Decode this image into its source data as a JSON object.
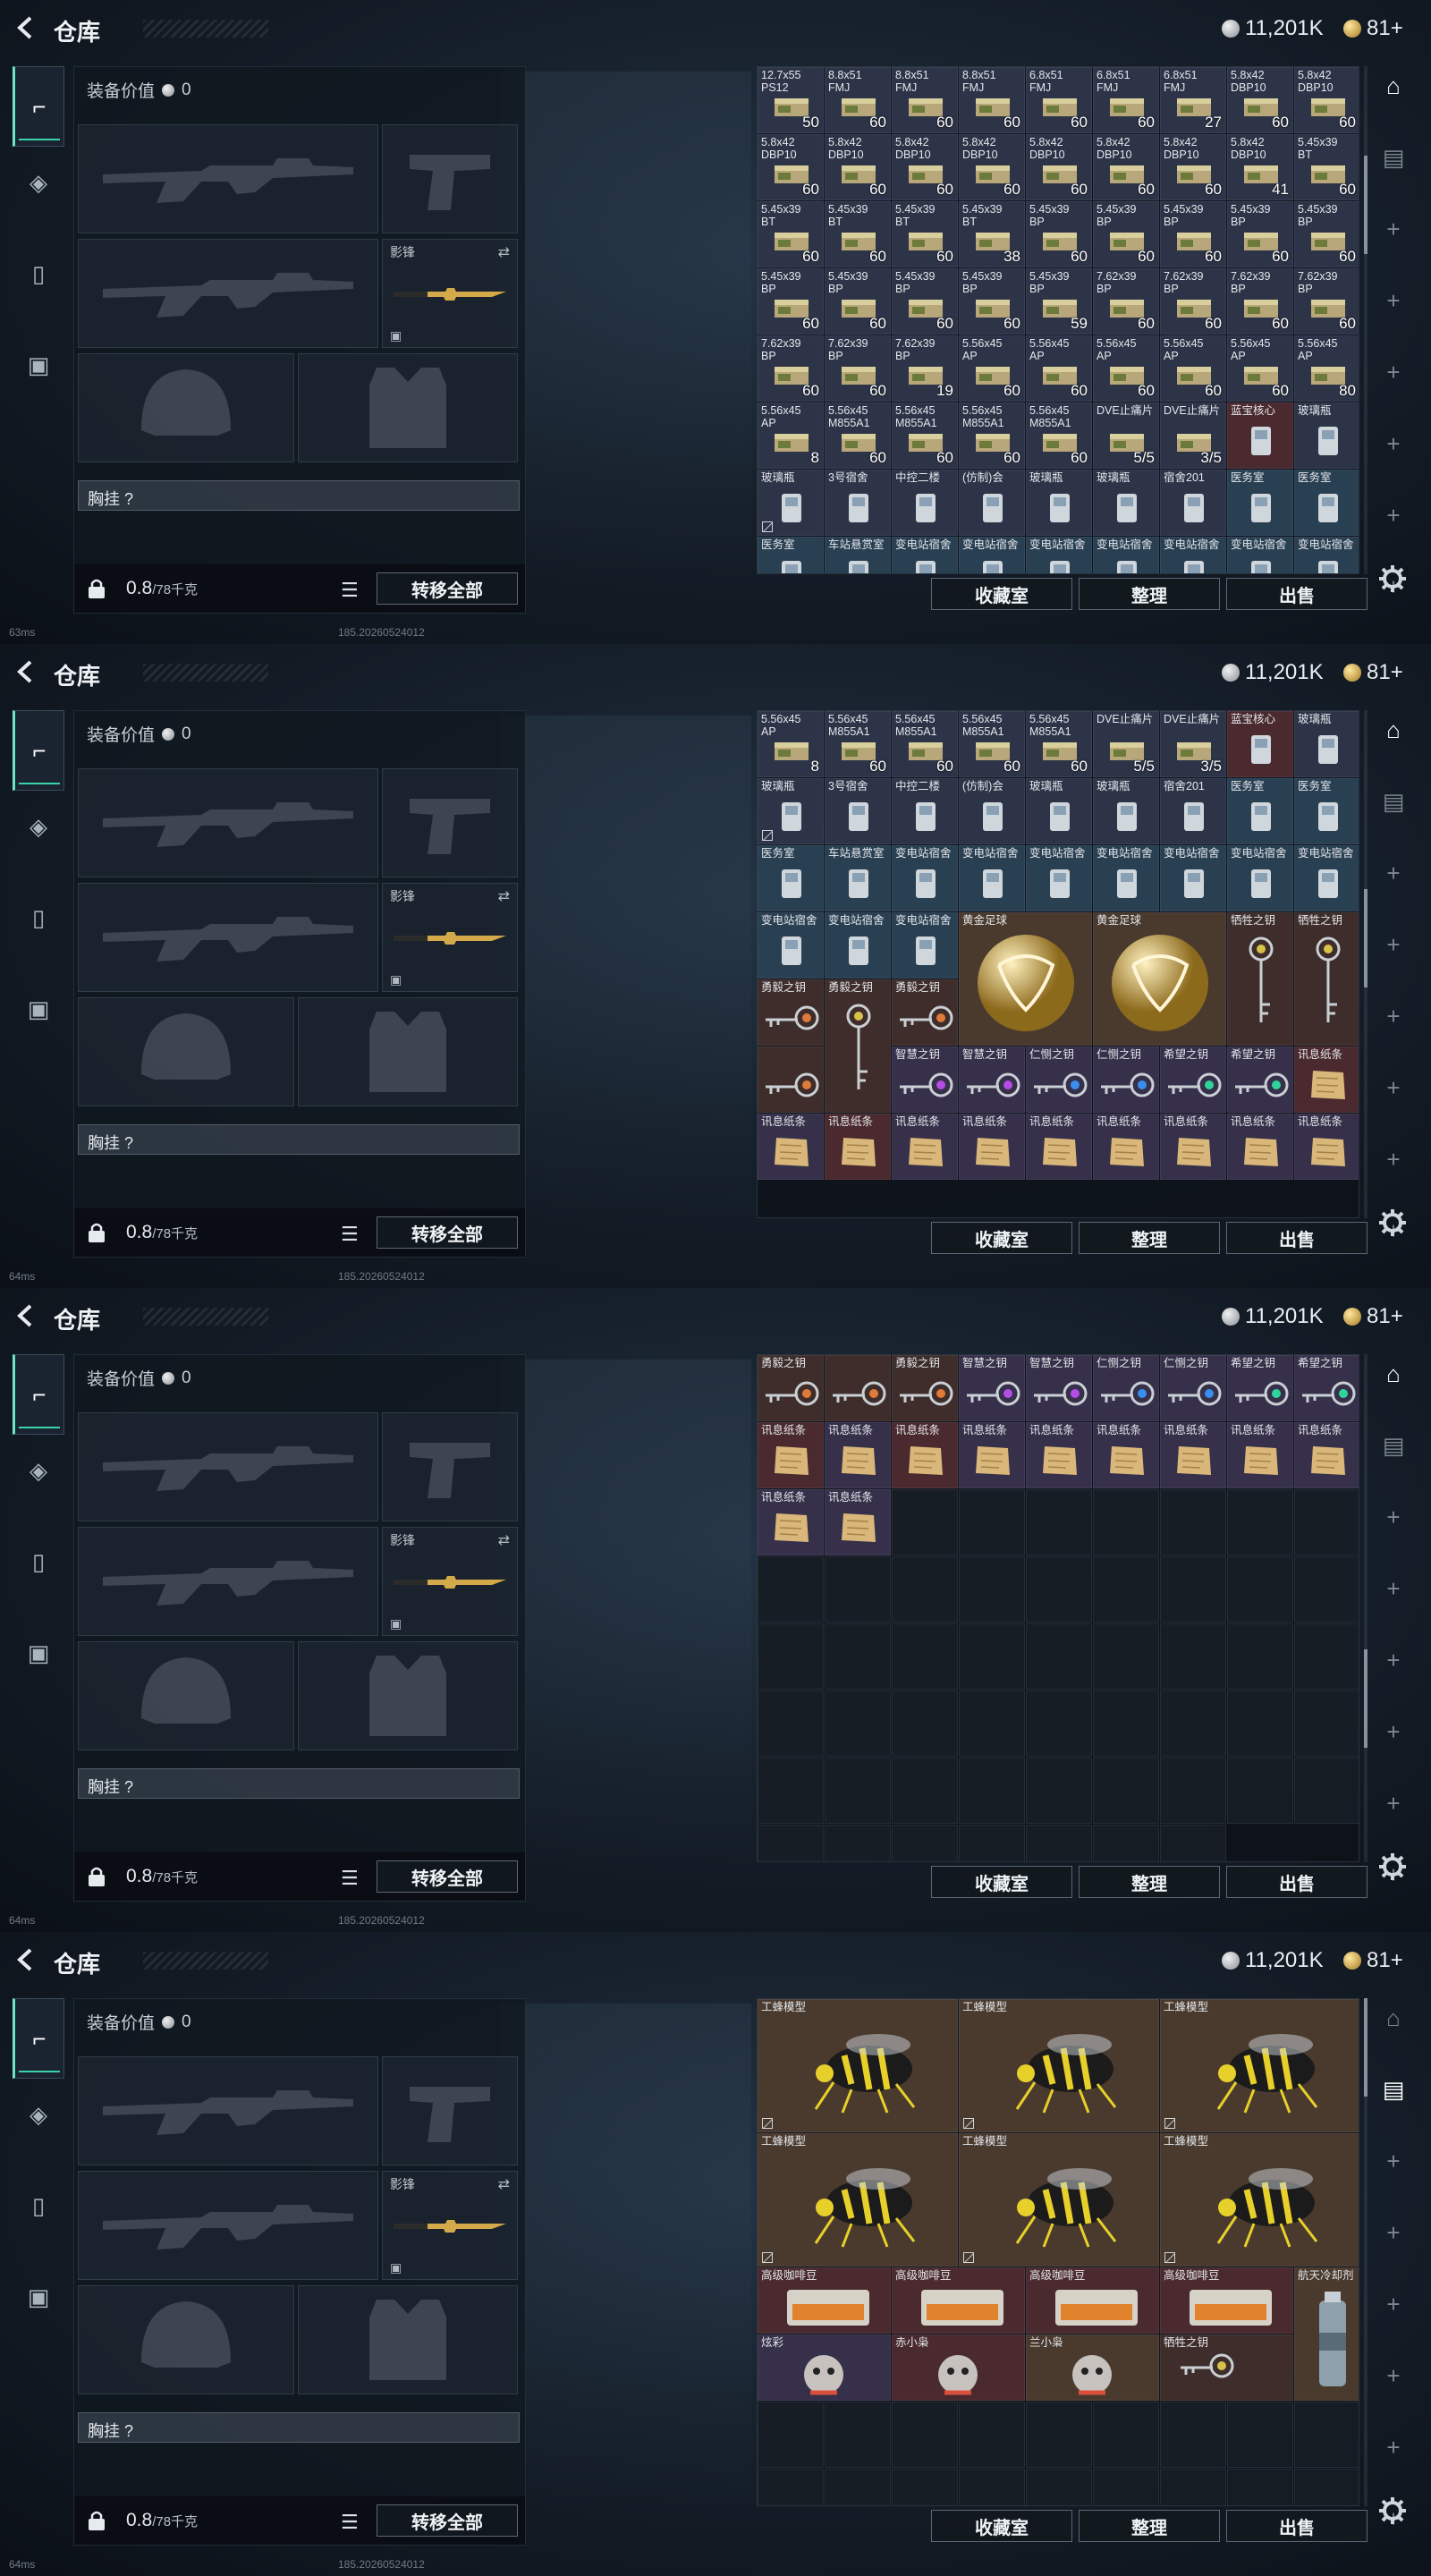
{
  "topbar": {
    "title": "仓库",
    "silver": "11,201K",
    "gold": "81+"
  },
  "equipment": {
    "value_label": "装备价值",
    "value": "0",
    "melee_label": "影锋",
    "chest_label": "胸挂 ?",
    "weight_value": "0.8",
    "weight_cap": "/78千克",
    "transfer_all": "转移全部"
  },
  "actions": {
    "collection": "收藏室",
    "sort": "整理",
    "sell": "出售"
  },
  "panels": [
    {
      "ping": "63ms",
      "version": "185.20260524012"
    },
    {
      "ping": "64ms",
      "version": "185.20260524012"
    },
    {
      "ping": "64ms",
      "version": "185.20260524012"
    },
    {
      "ping": "64ms",
      "version": "185.20260524012"
    }
  ],
  "grids": [
    [
      {
        "l": "12.7x55\nPS12",
        "c": "50",
        "t": "ammo"
      },
      {
        "l": "8.8x51\nFMJ",
        "c": "60",
        "t": "ammo"
      },
      {
        "l": "8.8x51\nFMJ",
        "c": "60",
        "t": "ammo"
      },
      {
        "l": "8.8x51\nFMJ",
        "c": "60",
        "t": "ammo"
      },
      {
        "l": "6.8x51\nFMJ",
        "c": "60",
        "t": "ammo"
      },
      {
        "l": "6.8x51\nFMJ",
        "c": "60",
        "t": "ammo"
      },
      {
        "l": "6.8x51\nFMJ",
        "c": "27",
        "t": "ammo"
      },
      {
        "l": "5.8x42\nDBP10",
        "c": "60",
        "t": "ammo"
      },
      {
        "l": "5.8x42\nDBP10",
        "c": "60",
        "t": "ammo"
      },
      {
        "l": "5.8x42\nDBP10",
        "c": "60",
        "t": "ammo"
      },
      {
        "l": "5.8x42\nDBP10",
        "c": "60",
        "t": "ammo"
      },
      {
        "l": "5.8x42\nDBP10",
        "c": "60",
        "t": "ammo"
      },
      {
        "l": "5.8x42\nDBP10",
        "c": "60",
        "t": "ammo"
      },
      {
        "l": "5.8x42\nDBP10",
        "c": "60",
        "t": "ammo"
      },
      {
        "l": "5.8x42\nDBP10",
        "c": "60",
        "t": "ammo"
      },
      {
        "l": "5.8x42\nDBP10",
        "c": "60",
        "t": "ammo"
      },
      {
        "l": "5.8x42\nDBP10",
        "c": "41",
        "t": "ammo"
      },
      {
        "l": "5.45x39\nBT",
        "c": "60",
        "t": "ammo"
      },
      {
        "l": "5.45x39\nBT",
        "c": "60",
        "t": "ammo"
      },
      {
        "l": "5.45x39\nBT",
        "c": "60",
        "t": "ammo"
      },
      {
        "l": "5.45x39\nBT",
        "c": "60",
        "t": "ammo"
      },
      {
        "l": "5.45x39\nBT",
        "c": "38",
        "t": "ammo"
      },
      {
        "l": "5.45x39\nBP",
        "c": "60",
        "t": "ammo"
      },
      {
        "l": "5.45x39\nBP",
        "c": "60",
        "t": "ammo"
      },
      {
        "l": "5.45x39\nBP",
        "c": "60",
        "t": "ammo"
      },
      {
        "l": "5.45x39\nBP",
        "c": "60",
        "t": "ammo"
      },
      {
        "l": "5.45x39\nBP",
        "c": "60",
        "t": "ammo"
      },
      {
        "l": "5.45x39\nBP",
        "c": "60",
        "t": "ammo"
      },
      {
        "l": "5.45x39\nBP",
        "c": "60",
        "t": "ammo"
      },
      {
        "l": "5.45x39\nBP",
        "c": "60",
        "t": "ammo"
      },
      {
        "l": "5.45x39\nBP",
        "c": "60",
        "t": "ammo"
      },
      {
        "l": "5.45x39\nBP",
        "c": "59",
        "t": "ammo"
      },
      {
        "l": "7.62x39\nBP",
        "c": "60",
        "t": "ammo"
      },
      {
        "l": "7.62x39\nBP",
        "c": "60",
        "t": "ammo"
      },
      {
        "l": "7.62x39\nBP",
        "c": "60",
        "t": "ammo"
      },
      {
        "l": "7.62x39\nBP",
        "c": "60",
        "t": "ammo"
      },
      {
        "l": "7.62x39\nBP",
        "c": "60",
        "t": "ammo"
      },
      {
        "l": "7.62x39\nBP",
        "c": "60",
        "t": "ammo"
      },
      {
        "l": "7.62x39\nBP",
        "c": "19",
        "t": "ammo"
      },
      {
        "l": "5.56x45\nAP",
        "c": "60",
        "t": "ammo"
      },
      {
        "l": "5.56x45\nAP",
        "c": "60",
        "t": "ammo"
      },
      {
        "l": "5.56x45\nAP",
        "c": "60",
        "t": "ammo"
      },
      {
        "l": "5.56x45\nAP",
        "c": "60",
        "t": "ammo"
      },
      {
        "l": "5.56x45\nAP",
        "c": "60",
        "t": "ammo"
      },
      {
        "l": "5.56x45\nAP",
        "c": "80",
        "t": "ammo"
      },
      {
        "l": "5.56x45\nAP",
        "c": "8",
        "t": "ammo"
      },
      {
        "l": "5.56x45\nM855A1",
        "c": "60",
        "t": "ammo"
      },
      {
        "l": "5.56x45\nM855A1",
        "c": "60",
        "t": "ammo"
      },
      {
        "l": "5.56x45\nM855A1",
        "c": "60",
        "t": "ammo"
      },
      {
        "l": "5.56x45\nM855A1",
        "c": "60",
        "t": "ammo"
      },
      {
        "l": "DVE止痛片",
        "c": "5/5",
        "t": "ammo"
      },
      {
        "l": "DVE止痛片",
        "c": "3/5",
        "t": "ammo"
      },
      {
        "l": "蓝宝核心",
        "c": "",
        "t": "redish"
      },
      {
        "l": "玻璃瓶",
        "c": "",
        "t": "ammo"
      },
      {
        "l": "玻璃瓶",
        "c": "",
        "t": "ammo",
        "nb": true
      },
      {
        "l": "3号宿舍",
        "c": "",
        "t": "ammo"
      },
      {
        "l": "中控二楼",
        "c": "",
        "t": "ammo"
      },
      {
        "l": "(仿制)会",
        "c": "",
        "t": "ammo"
      },
      {
        "l": "玻璃瓶",
        "c": "",
        "t": "ammo"
      },
      {
        "l": "玻璃瓶",
        "c": "",
        "t": "ammo"
      },
      {
        "l": "宿舍201",
        "c": "",
        "t": "ammo"
      },
      {
        "l": "医务室",
        "c": "",
        "t": "blue"
      },
      {
        "l": "医务室",
        "c": "",
        "t": "blue"
      },
      {
        "l": "医务室",
        "c": "",
        "t": "blue"
      },
      {
        "l": "车站悬赏室",
        "c": "",
        "t": "blue"
      },
      {
        "l": "变电站宿舍",
        "c": "",
        "t": "blue"
      },
      {
        "l": "变电站宿舍",
        "c": "",
        "t": "blue"
      },
      {
        "l": "变电站宿舍",
        "c": "",
        "t": "blue"
      },
      {
        "l": "变电站宿舍",
        "c": "",
        "t": "blue"
      },
      {
        "l": "变电站宿舍",
        "c": "",
        "t": "blue"
      },
      {
        "l": "变电站宿舍",
        "c": "",
        "t": "blue"
      },
      {
        "l": "变电站宿舍",
        "c": "",
        "t": "blue"
      }
    ],
    [
      {
        "l": "5.56x45\nAP",
        "c": "8",
        "t": "ammo"
      },
      {
        "l": "5.56x45\nM855A1",
        "c": "60",
        "t": "ammo"
      },
      {
        "l": "5.56x45\nM855A1",
        "c": "60",
        "t": "ammo"
      },
      {
        "l": "5.56x45\nM855A1",
        "c": "60",
        "t": "ammo"
      },
      {
        "l": "5.56x45\nM855A1",
        "c": "60",
        "t": "ammo"
      },
      {
        "l": "DVE止痛片",
        "c": "5/5",
        "t": "ammo"
      },
      {
        "l": "DVE止痛片",
        "c": "3/5",
        "t": "ammo"
      },
      {
        "l": "蓝宝核心",
        "c": "",
        "t": "redish"
      },
      {
        "l": "玻璃瓶",
        "c": "",
        "t": "ammo"
      },
      {
        "l": "玻璃瓶",
        "c": "",
        "t": "ammo",
        "nb": true
      },
      {
        "l": "3号宿舍",
        "c": "",
        "t": "ammo"
      },
      {
        "l": "中控二楼",
        "c": "",
        "t": "ammo"
      },
      {
        "l": "(仿制)会",
        "c": "",
        "t": "ammo"
      },
      {
        "l": "玻璃瓶",
        "c": "",
        "t": "ammo"
      },
      {
        "l": "玻璃瓶",
        "c": "",
        "t": "ammo"
      },
      {
        "l": "宿舍201",
        "c": "",
        "t": "ammo"
      },
      {
        "l": "医务室",
        "c": "",
        "t": "blue"
      },
      {
        "l": "医务室",
        "c": "",
        "t": "blue"
      },
      {
        "l": "医务室",
        "c": "",
        "t": "blue"
      },
      {
        "l": "车站悬赏室",
        "c": "",
        "t": "blue"
      },
      {
        "l": "变电站宿舍",
        "c": "",
        "t": "blue"
      },
      {
        "l": "变电站宿舍",
        "c": "",
        "t": "blue"
      },
      {
        "l": "变电站宿舍",
        "c": "",
        "t": "blue"
      },
      {
        "l": "变电站宿舍",
        "c": "",
        "t": "blue"
      },
      {
        "l": "变电站宿舍",
        "c": "",
        "t": "blue"
      },
      {
        "l": "变电站宿舍",
        "c": "",
        "t": "blue"
      },
      {
        "l": "变电站宿舍",
        "c": "",
        "t": "blue"
      },
      {
        "l": "变电站宿舍",
        "c": "",
        "t": "blue"
      },
      {
        "l": "变电站宿舍",
        "c": "",
        "t": "blue"
      },
      {
        "l": "变电站宿舍",
        "c": "",
        "t": "blue"
      },
      {
        "l": "黄金足球",
        "c": "",
        "t": "brown",
        "s": "big2",
        "a": "ball"
      },
      {
        "l": "黄金足球",
        "c": "",
        "t": "brown",
        "s": "big2",
        "a": "ball"
      },
      {
        "l": "牺牲之钥",
        "c": "",
        "t": "keyc",
        "s": "tall",
        "a": "vkey"
      },
      {
        "l": "牺牲之钥",
        "c": "",
        "t": "keyc",
        "s": "tall",
        "a": "vkey"
      },
      {
        "l": "勇毅之钥",
        "c": "",
        "t": "keyc",
        "a": "key",
        "k": "#e07a3a"
      },
      {
        "l": "勇毅之钥",
        "c": "",
        "t": "keyc",
        "s": "tall",
        "a": "vkey"
      },
      {
        "l": "勇毅之钥",
        "c": "",
        "t": "keyc",
        "a": "key",
        "k": "#e07a3a"
      },
      {
        "l": "",
        "c": "",
        "t": "keyc",
        "a": "key",
        "k": "#e07a3a"
      },
      {
        "l": "智慧之钥",
        "c": "",
        "t": "purple",
        "a": "key",
        "k": "#b44ce6"
      },
      {
        "l": "智慧之钥",
        "c": "",
        "t": "purple",
        "a": "key",
        "k": "#b44ce6"
      },
      {
        "l": "仁恻之钥",
        "c": "",
        "t": "purple",
        "a": "key",
        "k": "#3a8ef0"
      },
      {
        "l": "仁恻之钥",
        "c": "",
        "t": "purple",
        "a": "key",
        "k": "#3a8ef0"
      },
      {
        "l": "希望之钥",
        "c": "",
        "t": "purple",
        "a": "key",
        "k": "#2fd39c"
      },
      {
        "l": "希望之钥",
        "c": "",
        "t": "purple",
        "a": "key",
        "k": "#2fd39c"
      },
      {
        "l": "讯息纸条",
        "c": "",
        "t": "redish",
        "a": "paper"
      },
      {
        "l": "讯息纸条",
        "c": "",
        "t": "purple",
        "a": "paper"
      },
      {
        "l": "讯息纸条",
        "c": "",
        "t": "redish",
        "a": "paper"
      },
      {
        "l": "讯息纸条",
        "c": "",
        "t": "purple",
        "a": "paper"
      },
      {
        "l": "讯息纸条",
        "c": "",
        "t": "purple",
        "a": "paper"
      },
      {
        "l": "讯息纸条",
        "c": "",
        "t": "purple",
        "a": "paper"
      },
      {
        "l": "讯息纸条",
        "c": "",
        "t": "purple",
        "a": "paper"
      },
      {
        "l": "讯息纸条",
        "c": "",
        "t": "purple",
        "a": "paper"
      },
      {
        "l": "讯息纸条",
        "c": "",
        "t": "purple",
        "a": "paper"
      },
      {
        "l": "讯息纸条",
        "c": "",
        "t": "purple",
        "a": "paper"
      }
    ],
    [
      {
        "l": "勇毅之钥",
        "c": "",
        "t": "keyc",
        "a": "key",
        "k": "#e07a3a"
      },
      {
        "l": "",
        "c": "",
        "t": "keyc",
        "a": "key",
        "k": "#e07a3a"
      },
      {
        "l": "勇毅之钥",
        "c": "",
        "t": "keyc",
        "a": "key",
        "k": "#e07a3a"
      },
      {
        "l": "智慧之钥",
        "c": "",
        "t": "purple",
        "a": "key",
        "k": "#b44ce6"
      },
      {
        "l": "智慧之钥",
        "c": "",
        "t": "purple",
        "a": "key",
        "k": "#b44ce6"
      },
      {
        "l": "仁恻之钥",
        "c": "",
        "t": "purple",
        "a": "key",
        "k": "#3a8ef0"
      },
      {
        "l": "仁恻之钥",
        "c": "",
        "t": "purple",
        "a": "key",
        "k": "#3a8ef0"
      },
      {
        "l": "希望之钥",
        "c": "",
        "t": "purple",
        "a": "key",
        "k": "#2fd39c"
      },
      {
        "l": "希望之钥",
        "c": "",
        "t": "purple",
        "a": "key",
        "k": "#2fd39c"
      },
      {
        "l": "讯息纸条",
        "c": "",
        "t": "redish",
        "a": "paper"
      },
      {
        "l": "讯息纸条",
        "c": "",
        "t": "purple",
        "a": "paper"
      },
      {
        "l": "讯息纸条",
        "c": "",
        "t": "redish",
        "a": "paper"
      },
      {
        "l": "讯息纸条",
        "c": "",
        "t": "purple",
        "a": "paper"
      },
      {
        "l": "讯息纸条",
        "c": "",
        "t": "purple",
        "a": "paper"
      },
      {
        "l": "讯息纸条",
        "c": "",
        "t": "purple",
        "a": "paper"
      },
      {
        "l": "讯息纸条",
        "c": "",
        "t": "purple",
        "a": "paper"
      },
      {
        "l": "讯息纸条",
        "c": "",
        "t": "purple",
        "a": "paper"
      },
      {
        "l": "讯息纸条",
        "c": "",
        "t": "purple",
        "a": "paper"
      },
      {
        "l": "讯息纸条",
        "c": "",
        "t": "purple",
        "a": "paper"
      },
      {
        "l": "讯息纸条",
        "c": "",
        "t": "purple",
        "a": "paper"
      }
    ],
    [
      {
        "l": "工蜂模型",
        "c": "",
        "t": "brown",
        "s": "big3",
        "a": "bee",
        "nb": true
      },
      {
        "l": "工蜂模型",
        "c": "",
        "t": "brown",
        "s": "big3",
        "a": "bee",
        "nb": true
      },
      {
        "l": "工蜂模型",
        "c": "",
        "t": "brown",
        "s": "big3",
        "a": "bee",
        "nb": true
      },
      {
        "l": "工蜂模型",
        "c": "",
        "t": "brown",
        "s": "big3",
        "a": "bee",
        "nb": true
      },
      {
        "l": "工蜂模型",
        "c": "",
        "t": "brown",
        "s": "big3",
        "a": "bee",
        "nb": true
      },
      {
        "l": "工蜂模型",
        "c": "",
        "t": "brown",
        "s": "big3",
        "a": "bee",
        "nb": true
      },
      {
        "l": "高级咖啡豆",
        "c": "",
        "t": "redish",
        "s": "wide2",
        "a": "coffee"
      },
      {
        "l": "高级咖啡豆",
        "c": "",
        "t": "redish",
        "s": "wide2",
        "a": "coffee"
      },
      {
        "l": "高级咖啡豆",
        "c": "",
        "t": "redish",
        "s": "wide2",
        "a": "coffee"
      },
      {
        "l": "高级咖啡豆",
        "c": "",
        "t": "redish",
        "s": "wide2",
        "a": "coffee"
      },
      {
        "l": "航天冷却剂",
        "c": "",
        "t": "brown",
        "s": "tall",
        "a": "can"
      },
      {
        "l": "炫彩",
        "c": "",
        "t": "purple",
        "s": "wide2",
        "a": "toy"
      },
      {
        "l": "赤小枭",
        "c": "",
        "t": "redish",
        "s": "wide2",
        "a": "toy"
      },
      {
        "l": "兰小枭",
        "c": "",
        "t": "brown",
        "s": "wide2",
        "a": "toy"
      },
      {
        "l": "牺牲之钥",
        "c": "",
        "t": "keyc",
        "s": "wide2",
        "a": "key",
        "k": "#d8c24a"
      }
    ]
  ],
  "rightrail": [
    {
      "name": "storage-tab",
      "sym": "⌂",
      "active": true
    },
    {
      "name": "safebox-tab",
      "sym": "▤",
      "active": false
    },
    {
      "name": "add-page-1",
      "sym": "+",
      "active": false
    },
    {
      "name": "add-page-2",
      "sym": "+",
      "active": false
    },
    {
      "name": "add-page-3",
      "sym": "+",
      "active": false
    },
    {
      "name": "add-page-4",
      "sym": "+",
      "active": false
    },
    {
      "name": "add-page-5",
      "sym": "+",
      "active": false
    },
    {
      "name": "add-page-6",
      "sym": "+",
      "active": false
    }
  ],
  "colors": {
    "accent": "#3ad2a6",
    "cell_ammo": "#2d3448",
    "cell_key": "#3e2d2a",
    "cell_purple": "#36304a",
    "cell_blue": "#293f52"
  }
}
